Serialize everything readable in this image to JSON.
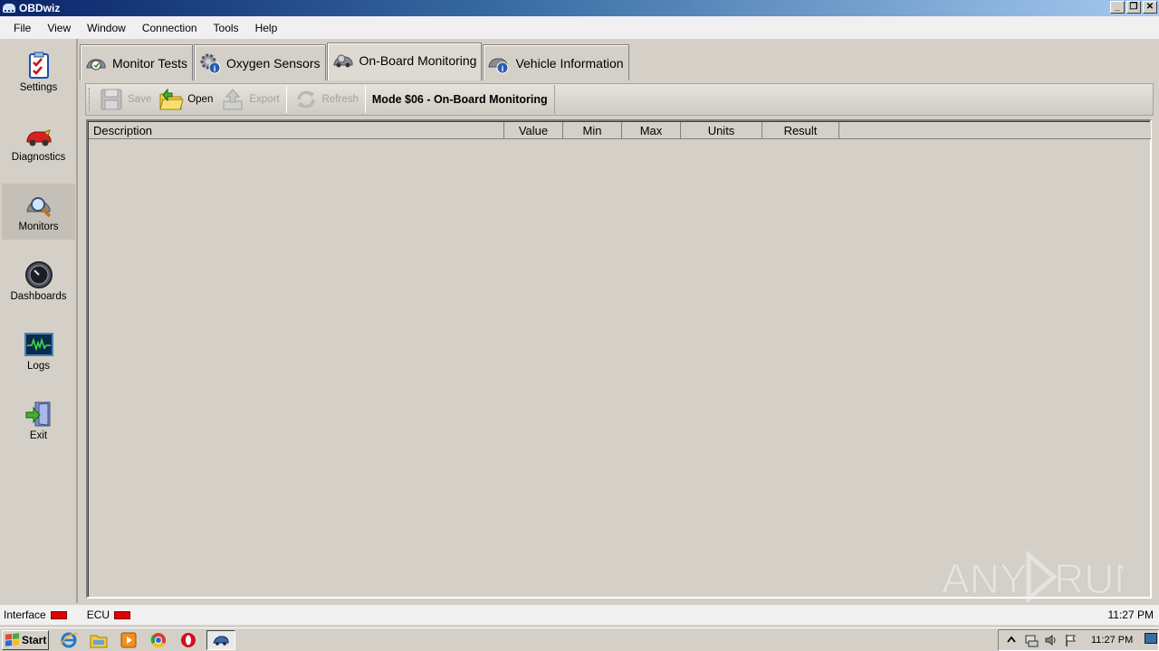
{
  "window": {
    "title": "OBDwiz",
    "controls": [
      "_",
      "❐",
      "✕"
    ]
  },
  "menu": [
    "File",
    "View",
    "Window",
    "Connection",
    "Tools",
    "Help"
  ],
  "sidebar": {
    "items": [
      {
        "label": "Settings",
        "icon": "settings-checklist-icon"
      },
      {
        "label": "Diagnostics",
        "icon": "diagnostics-car-icon"
      },
      {
        "label": "Monitors",
        "icon": "monitors-magnifier-icon"
      },
      {
        "label": "Dashboards",
        "icon": "dashboards-gauge-icon"
      },
      {
        "label": "Logs",
        "icon": "logs-waveform-icon"
      },
      {
        "label": "Exit",
        "icon": "exit-door-icon"
      }
    ],
    "active": "Monitors"
  },
  "tabs": [
    {
      "label": "Monitor Tests"
    },
    {
      "label": "Oxygen Sensors"
    },
    {
      "label": "On-Board Monitoring"
    },
    {
      "label": "Vehicle Information"
    }
  ],
  "active_tab": "On-Board Monitoring",
  "toolbar": {
    "save": "Save",
    "open": "Open",
    "export": "Export",
    "refresh": "Refresh",
    "title": "Mode $06 - On-Board Monitoring"
  },
  "table": {
    "columns": [
      "Description",
      "Value",
      "Min",
      "Max",
      "Units",
      "Result"
    ],
    "rows": []
  },
  "status": {
    "interface_label": "Interface",
    "ecu_label": "ECU",
    "interface_color": "#e00000",
    "ecu_color": "#e00000",
    "time": "11:27 PM"
  },
  "watermark": "ANY RUN",
  "taskbar": {
    "start": "Start",
    "clock": "11:27 PM"
  }
}
